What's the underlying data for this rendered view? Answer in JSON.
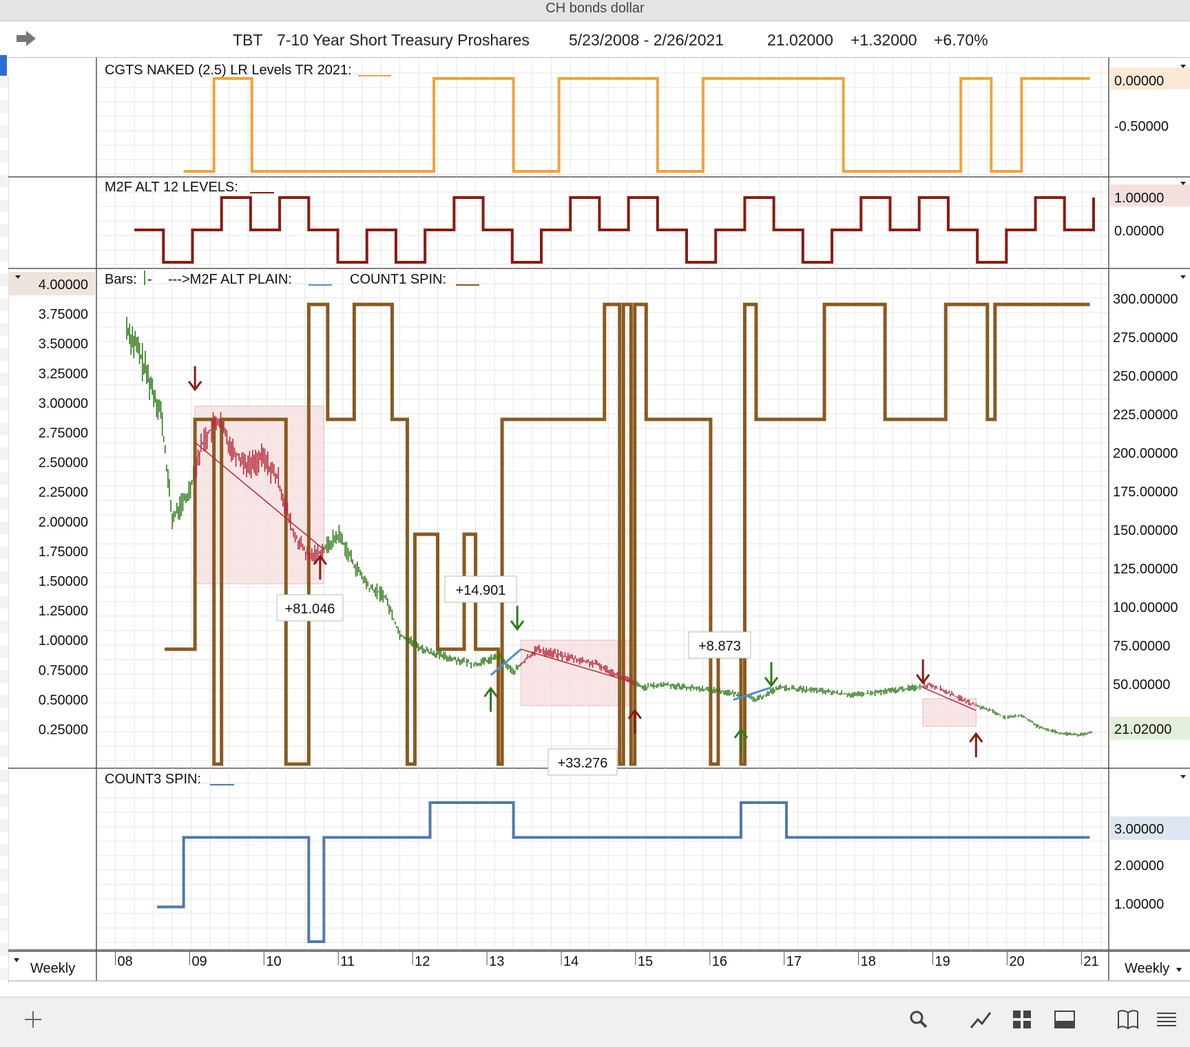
{
  "window": {
    "title": "CH bonds dollar"
  },
  "header": {
    "symbol": "TBT",
    "name": "7-10 Year Short Treasury Proshares",
    "range": "5/23/2008 - 2/26/2021",
    "last": "21.02000",
    "change": "+1.32000",
    "pct": "+6.70%"
  },
  "colors": {
    "orange": "#f0a33a",
    "darkred": "#8b1a10",
    "brown": "#8a5a1f",
    "blue": "#4f79ae",
    "green": "#2f7a1a",
    "red": "#b8283a",
    "trade_shade": "#f5dcdc"
  },
  "panels": {
    "cgts": {
      "title": "CGTS NAKED (2.5) LR Levels TR 2021:",
      "right_ticks": [
        "0.00000",
        "-0.50000"
      ],
      "highlight": "0.00000"
    },
    "m2f": {
      "title": "M2F ALT 12 LEVELS:",
      "right_ticks": [
        "1.00000",
        "0.00000"
      ],
      "highlight": "1.00000"
    },
    "main": {
      "legend_bars": "Bars:",
      "legend_bars_suffix": "-",
      "legend_m2f": "--->M2F ALT PLAIN:",
      "legend_count1": "COUNT1 SPIN:",
      "left_ticks": [
        "4.00000",
        "3.75000",
        "3.50000",
        "3.25000",
        "3.00000",
        "2.75000",
        "2.50000",
        "2.25000",
        "2.00000",
        "1.75000",
        "1.50000",
        "1.25000",
        "1.00000",
        "0.75000",
        "0.50000",
        "0.25000"
      ],
      "right_ticks": [
        "300.00000",
        "275.00000",
        "250.00000",
        "225.00000",
        "200.00000",
        "175.00000",
        "150.00000",
        "125.00000",
        "100.00000",
        "75.00000",
        "50.00000"
      ],
      "price_label": "21.02000",
      "trade_labels": [
        {
          "text": "+81.046",
          "color": "#8b1a10"
        },
        {
          "text": "+14.901",
          "color": "#2f7a1a"
        },
        {
          "text": "+33.276",
          "color": "#8b1a10"
        },
        {
          "text": "+8.873",
          "color": "#2f7a1a"
        }
      ]
    },
    "count3": {
      "title": "COUNT3 SPIN:",
      "right_ticks": [
        "3.00000",
        "2.00000",
        "1.00000"
      ],
      "highlight": "3.00000"
    }
  },
  "x_axis": {
    "labels": [
      "08",
      "09",
      "10",
      "11",
      "12",
      "13",
      "14",
      "15",
      "16",
      "17",
      "18",
      "19",
      "20",
      "21"
    ],
    "period_left": "Weekly",
    "period_right": "Weekly"
  },
  "chart_data": [
    {
      "type": "line",
      "title": "CGTS NAKED (2.5) LR Levels TR 2021:",
      "x": [
        "2009.15",
        "2009.55",
        "2009.55",
        "2010.05",
        "2010.05",
        "2012.45",
        "2012.45",
        "2013.5",
        "2013.5",
        "2014.1",
        "2014.1",
        "2015.4",
        "2015.4",
        "2016.0",
        "2016.0",
        "2017.85",
        "2017.85",
        "2019.4",
        "2019.4",
        "2019.8",
        "2019.8",
        "2020.2",
        "2020.2",
        "2021.1"
      ],
      "series": [
        {
          "values": [
            -1,
            -1,
            0,
            0,
            -1,
            -1,
            0,
            0,
            -1,
            -1,
            0,
            0,
            -1,
            -1,
            0,
            0,
            -1,
            -1,
            0,
            0,
            -1,
            -1,
            0,
            0
          ]
        }
      ],
      "ylim": [
        -1.1,
        0.1
      ]
    },
    {
      "type": "line",
      "title": "M2F ALT 12 LEVELS:",
      "note_levels": "steps between -1, 0 and 1",
      "series": [
        {
          "values": [
            0,
            -1,
            0,
            1,
            0,
            1,
            0,
            -1,
            0,
            -1,
            0,
            1,
            0,
            -1,
            0,
            1,
            0,
            1,
            0,
            -1,
            0,
            1,
            0,
            -1,
            0,
            1,
            0,
            1,
            0,
            -1,
            0,
            1,
            0,
            1
          ]
        }
      ],
      "ylim": [
        -1.2,
        1.2
      ]
    },
    {
      "type": "line",
      "title": "Bars / M2F ALT PLAIN / COUNT1 SPIN",
      "series": [
        {
          "name": "Bars",
          "y_axis": "right",
          "x": [
            "2008.4",
            "2008.55",
            "2008.7",
            "2008.85",
            "2009.0",
            "2009.2",
            "2009.4",
            "2009.6",
            "2009.8",
            "2010.0",
            "2010.2",
            "2010.4",
            "2010.6",
            "2010.8",
            "2011.0",
            "2011.2",
            "2011.4",
            "2011.6",
            "2011.8",
            "2012.0",
            "2012.3",
            "2012.6",
            "2013.0",
            "2013.3",
            "2013.5",
            "2013.8",
            "2014.2",
            "2014.6",
            "2015.0",
            "2015.2",
            "2015.5",
            "2015.8",
            "2016.2",
            "2016.5",
            "2016.7",
            "2017.0",
            "2017.5",
            "2018.0",
            "2018.5",
            "2018.8",
            "2019.0",
            "2019.3",
            "2019.6",
            "2019.8",
            "2020.0",
            "2020.2",
            "2020.4",
            "2020.7",
            "2021.0",
            "2021.15"
          ],
          "values": [
            285,
            270,
            250,
            230,
            160,
            175,
            210,
            225,
            205,
            195,
            200,
            185,
            150,
            135,
            140,
            150,
            130,
            115,
            110,
            85,
            75,
            70,
            65,
            70,
            60,
            75,
            70,
            65,
            55,
            50,
            52,
            50,
            48,
            45,
            42,
            50,
            48,
            45,
            48,
            50,
            52,
            45,
            38,
            35,
            30,
            32,
            25,
            20,
            19,
            21
          ]
        },
        {
          "name": "COUNT1 SPIN",
          "y_axis": "right",
          "note": "step lines between 0 and 300"
        }
      ],
      "ylim_left": [
        0.0,
        4.0
      ],
      "ylim_right": [
        0,
        310
      ]
    },
    {
      "type": "line",
      "title": "COUNT3 SPIN:",
      "x": [
        "2008.8",
        "2009.15",
        "2009.15",
        "2010.8",
        "2010.8",
        "2011.0",
        "2011.0",
        "2012.4",
        "2012.4",
        "2013.5",
        "2013.5",
        "2016.5",
        "2016.5",
        "2017.1",
        "2017.1",
        "2021.1"
      ],
      "series": [
        {
          "values": [
            1,
            1,
            3,
            3,
            0,
            0,
            3,
            3,
            4,
            4,
            3,
            3,
            4,
            4,
            3,
            3
          ]
        }
      ],
      "ylim": [
        0,
        4.2
      ]
    }
  ]
}
